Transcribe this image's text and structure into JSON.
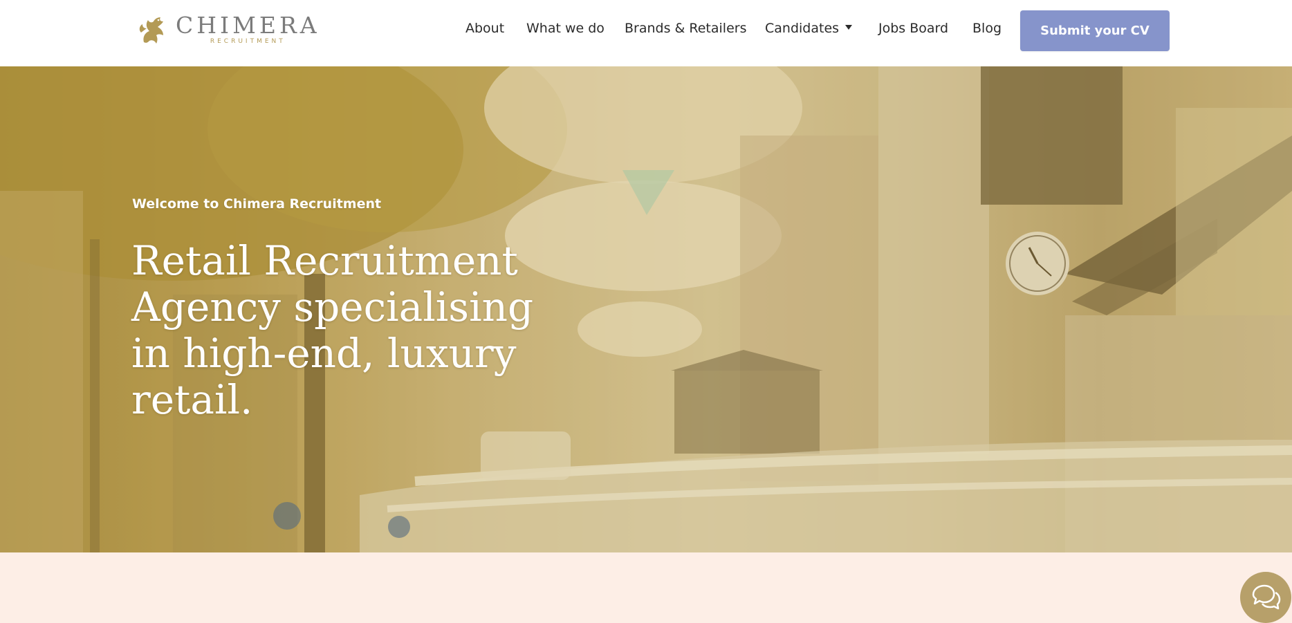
{
  "header": {
    "logo": {
      "main": "CHIMERA",
      "sub": "RECRUITMENT",
      "icon": "griffin-logo-icon"
    },
    "nav": {
      "items": [
        {
          "label": "About"
        },
        {
          "label": "What we do"
        },
        {
          "label": "Brands & Retailers"
        },
        {
          "label": "Candidates",
          "has_dropdown": true
        },
        {
          "label": "Jobs Board"
        },
        {
          "label": "Blog"
        }
      ],
      "dropdown_icon": "caret-down-icon"
    },
    "cta": {
      "label": "Submit your CV"
    }
  },
  "hero": {
    "eyebrow": "Welcome to Chimera Recruitment",
    "headline_lines": [
      "Retail Recruitment",
      "Agency specialising",
      "in high-end, luxury",
      "retail."
    ],
    "background": "street-photo"
  },
  "chat": {
    "icon": "chat-bubbles-icon"
  },
  "colors": {
    "cta": "#8694cb",
    "nav_text": "#2b2b2b",
    "hero_tint": "#c8b27a",
    "page_bg": "#fdeee6",
    "chat_bg": "#b7a06a"
  }
}
